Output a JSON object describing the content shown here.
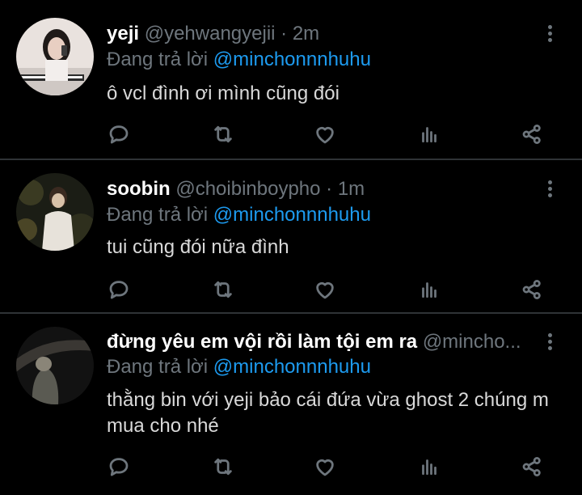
{
  "tweets": [
    {
      "name": "yeji",
      "handle": "@yehwangyejii",
      "sep": " · ",
      "time": "2m",
      "reply_prefix": "Đang trả lời ",
      "reply_to": "@minchonnnhuhu",
      "text": "ô vcl đình ơi mình cũng đói"
    },
    {
      "name": "soobin",
      "handle": "@choibinboypho",
      "sep": " · ",
      "time": "1m",
      "reply_prefix": "Đang trả lời ",
      "reply_to": "@minchonnnhuhu",
      "text": "tui cũng đói nữa đình"
    },
    {
      "name": "đừng yêu em vội rồi làm tội em ra",
      "handle": "@mincho...",
      "sep": "",
      "time": "",
      "reply_prefix": "Đang trả lời ",
      "reply_to": "@minchonnnhuhu",
      "text": "thằng bin với yeji bảo cái đứa vừa ghost 2 chúng m mua cho nhé"
    }
  ],
  "icons": [
    "reply-icon",
    "retweet-icon",
    "like-icon",
    "analytics-icon",
    "share-icon",
    "more-icon"
  ],
  "colors": {
    "background": "#000000",
    "mention": "#1d9bf0",
    "muted": "#6e767d",
    "text": "#d9d9d9",
    "divider": "#2f3336"
  }
}
